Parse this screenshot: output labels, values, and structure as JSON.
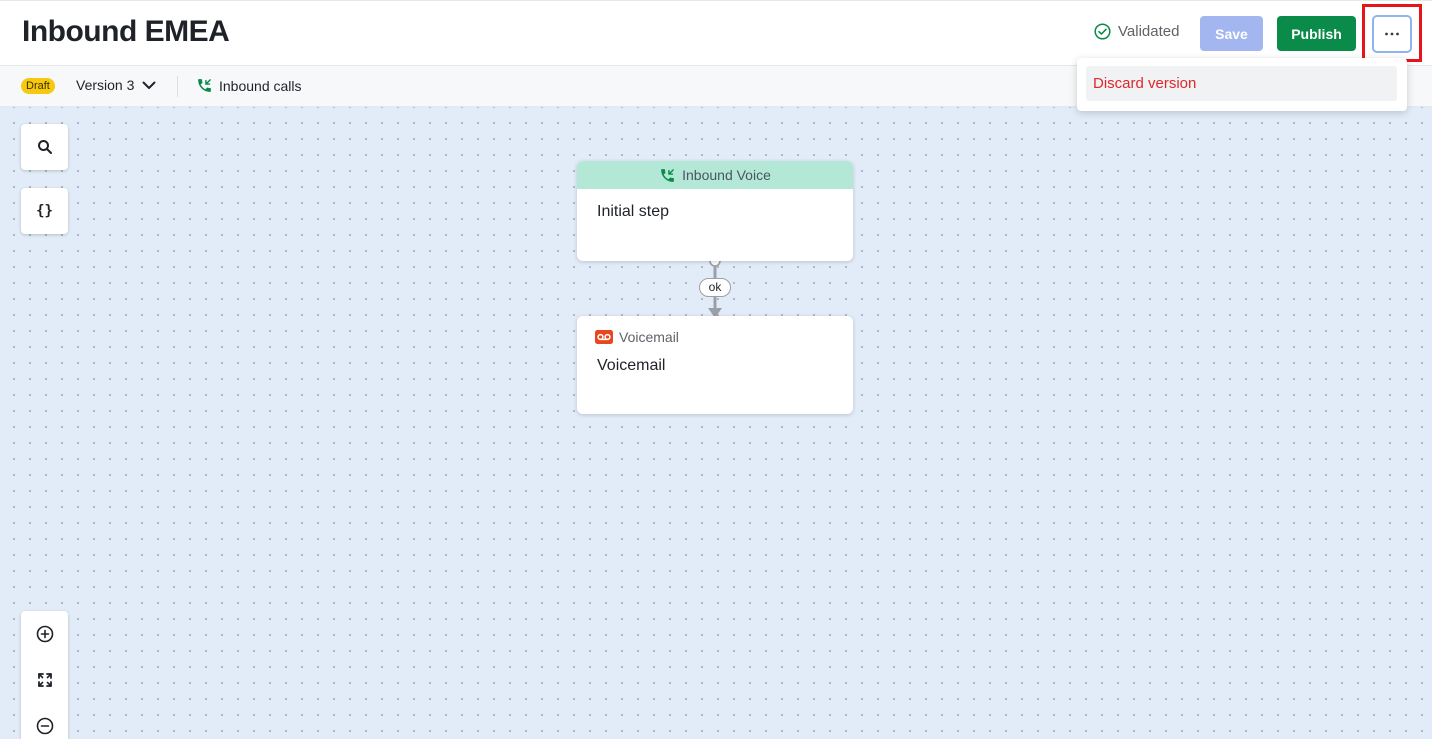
{
  "header": {
    "title": "Inbound EMEA",
    "status_label": "Validated",
    "save_label": "Save",
    "publish_label": "Publish",
    "more_icon": "more-horizontal-icon"
  },
  "subbar": {
    "badge": "Draft",
    "version_label": "Version 3",
    "trigger_label": "Inbound calls"
  },
  "menu": {
    "items": [
      {
        "label": "Discard version",
        "color": "#e0262b"
      }
    ]
  },
  "canvas": {
    "tools": {
      "search_icon": "search-icon",
      "variables_label": "{}"
    },
    "zoom": [
      "zoom-in-icon",
      "fit-view-icon",
      "zoom-out-icon"
    ]
  },
  "flow": {
    "nodes": [
      {
        "id": "start",
        "header": "Inbound Voice",
        "title": "Initial step",
        "header_color": "#b4e8d6"
      },
      {
        "id": "voicemail",
        "type_label": "Voicemail",
        "title": "Voicemail"
      }
    ],
    "edges": [
      {
        "from": "start",
        "to": "voicemail",
        "label": "ok"
      }
    ]
  },
  "colors": {
    "publish": "#0a8b4a",
    "save_disabled": "#a3b6f0",
    "draft_badge": "#f6c90e",
    "validated_icon": "#0a8b4a",
    "canvas_bg": "#e2ecf9",
    "highlight": "#e8141c"
  }
}
